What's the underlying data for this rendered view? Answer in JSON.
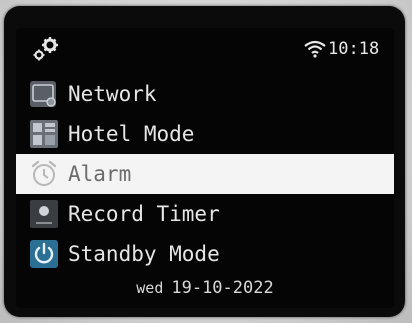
{
  "status": {
    "logo_icon": "settings-gears-icon",
    "wifi_icon": "wifi-icon",
    "time": "10:18"
  },
  "menu": {
    "items": [
      {
        "label": "Network",
        "icon": "network-icon",
        "selected": false
      },
      {
        "label": "Hotel Mode",
        "icon": "hotel-mode-icon",
        "selected": false
      },
      {
        "label": "Alarm",
        "icon": "alarm-clock-icon",
        "selected": true
      },
      {
        "label": "Record Timer",
        "icon": "record-icon",
        "selected": false
      },
      {
        "label": "Standby Mode",
        "icon": "power-icon",
        "selected": false
      }
    ]
  },
  "footer": {
    "day": "wed",
    "date": "19-10-2022"
  },
  "colors": {
    "screen_bg": "#050505",
    "text": "#e6e6e6",
    "selection_bg": "#f4f4f4",
    "selection_text": "#6b6b6b"
  }
}
